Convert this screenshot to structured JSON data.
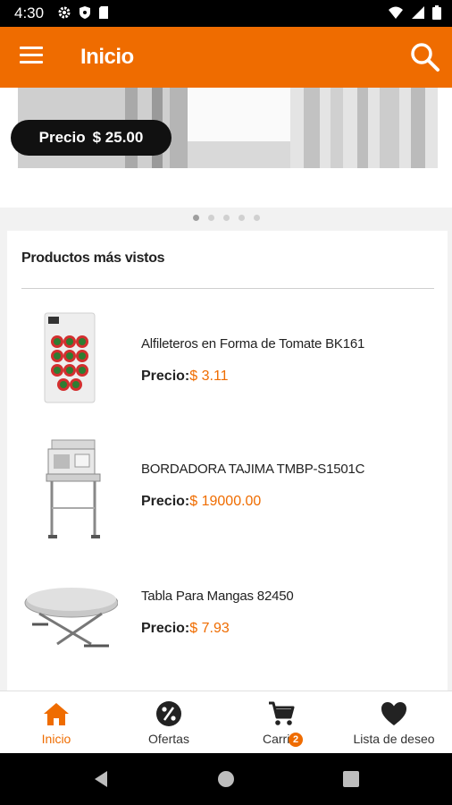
{
  "status_bar": {
    "time": "4:30"
  },
  "app_bar": {
    "title": "Inicio"
  },
  "banner": {
    "price_label": "Precio",
    "price_value": "$ 25.00",
    "slides": 5,
    "active_slide": 0
  },
  "section": {
    "title": "Productos más vistos"
  },
  "products": [
    {
      "name": "Alfileteros en Forma de Tomate BK161",
      "price_label": "Precio:",
      "price": "$ 3.11"
    },
    {
      "name": "BORDADORA TAJIMA TMBP-S1501C",
      "price_label": "Precio:",
      "price": "$ 19000.00"
    },
    {
      "name": "Tabla Para Mangas 82450",
      "price_label": "Precio:",
      "price": "$ 7.93"
    }
  ],
  "bottom_nav": [
    {
      "label": "Inicio",
      "icon": "home-icon",
      "active": true
    },
    {
      "label": "Ofertas",
      "icon": "percent-icon",
      "active": false
    },
    {
      "label": "Carrito",
      "icon": "cart-icon",
      "active": false,
      "badge": "2"
    },
    {
      "label": "Lista de deseo",
      "icon": "heart-icon",
      "active": false
    }
  ],
  "colors": {
    "accent": "#ef6c00",
    "dark": "#111111"
  }
}
